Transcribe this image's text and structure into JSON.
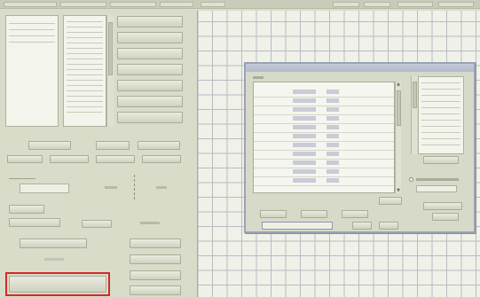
{
  "colors": {
    "window_bg": "#d9dcc9",
    "grid_bg": "#f0f1e8",
    "grid_line": "#b9bcc3",
    "dialog_border": "#9aa2b8",
    "highlight": "#d22b2b"
  },
  "icons": {
    "scroll_up": "scroll-up-icon",
    "scroll_down": "scroll-down-icon"
  }
}
